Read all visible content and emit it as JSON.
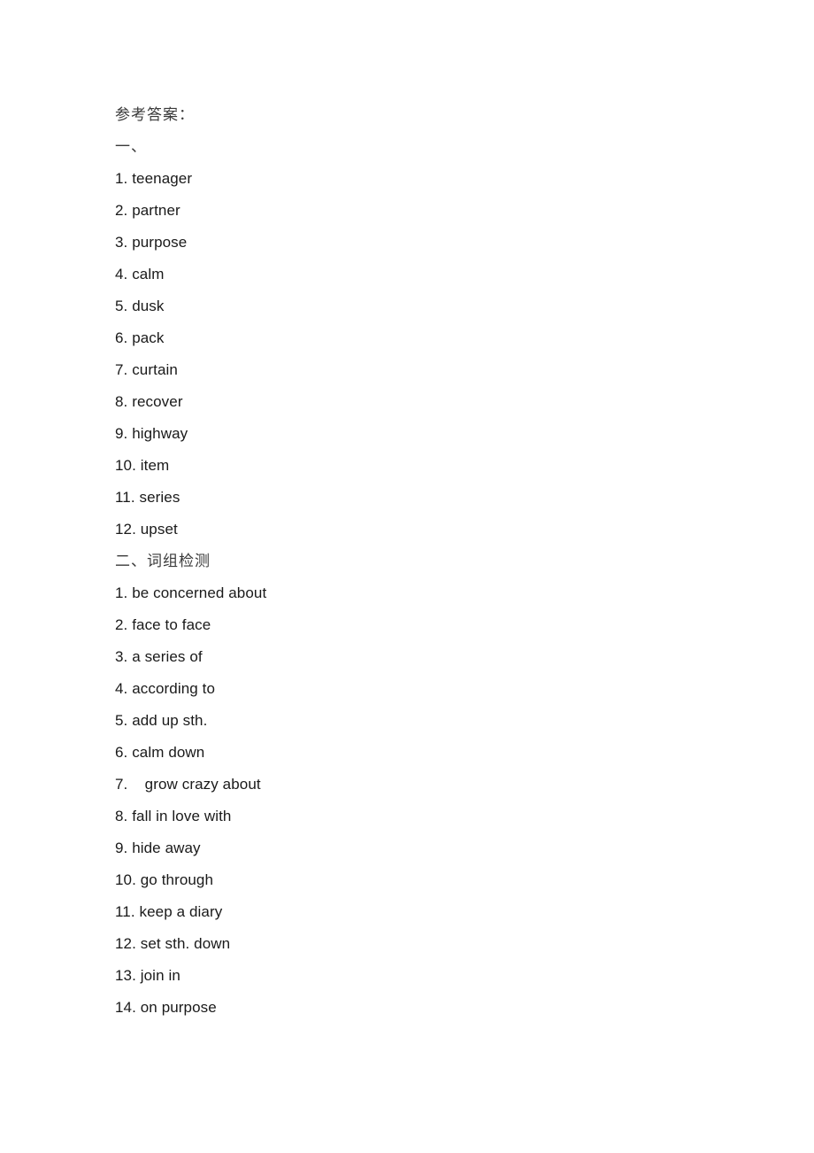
{
  "document": {
    "title": "参考答案：",
    "section_one": {
      "heading": "一、",
      "items": [
        "1. teenager",
        "2. partner",
        "3. purpose",
        "4. calm",
        "5. dusk",
        "6. pack",
        "7. curtain",
        "8. recover",
        "9. highway",
        "10. item",
        "11. series",
        "12. upset"
      ]
    },
    "section_two": {
      "heading": "二、词组检测",
      "items": [
        "1. be concerned about",
        "2. face to face",
        "3. a series of",
        "4. according to",
        "5. add up sth.",
        "6. calm down",
        "7.    grow crazy about",
        "8. fall in love with",
        "9. hide away",
        "10. go through",
        "11. keep a diary",
        "12. set sth. down",
        "13. join in",
        "14. on purpose"
      ]
    }
  },
  "colors": {
    "page_background": "#ffffff",
    "english_text": "#1a1a1a",
    "chinese_text": "#3a3a3a"
  }
}
